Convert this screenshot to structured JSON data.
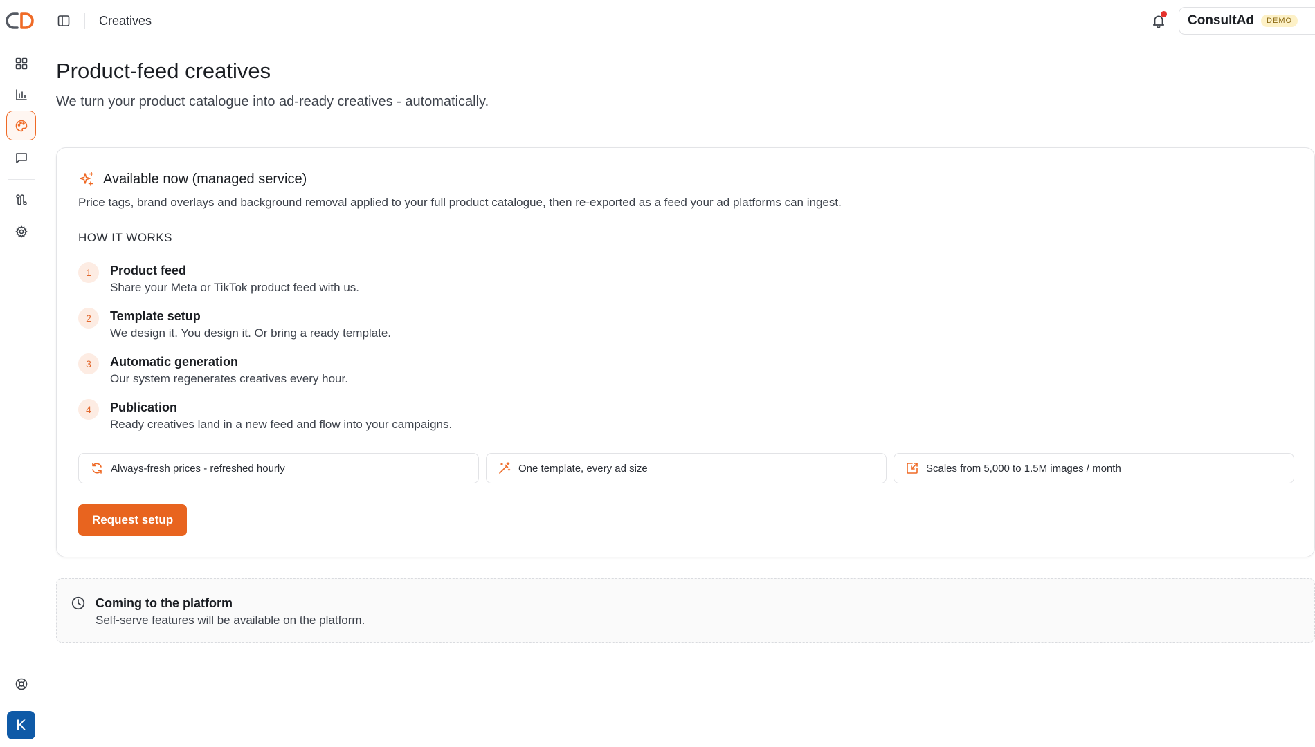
{
  "colors": {
    "accent": "#e8641f",
    "active_border": "#ef6a26",
    "avatar": "#0f5aa7",
    "notification_dot": "#e5322d"
  },
  "sidebar": {
    "items": [
      {
        "icon": "dashboard-icon"
      },
      {
        "icon": "bar-chart-icon"
      },
      {
        "icon": "palette-icon",
        "active": true
      },
      {
        "icon": "chat-icon"
      },
      {
        "icon": "integrations-icon"
      },
      {
        "icon": "gear-icon"
      },
      {
        "icon": "support-icon"
      }
    ],
    "avatar_initial": "K"
  },
  "header": {
    "breadcrumb": "Creatives",
    "workspace_name": "ConsultAd",
    "workspace_badge": "DEMO"
  },
  "page": {
    "title": "Product-feed creatives",
    "subtitle": "We turn your product catalogue into ad-ready creatives - automatically."
  },
  "card": {
    "title": "Available now (managed service)",
    "description": "Price tags, brand overlays and background removal applied to your full product catalogue, then re-exported as a feed your ad platforms can ingest.",
    "section_label": "HOW IT WORKS",
    "steps": [
      {
        "num": "1",
        "title": "Product feed",
        "desc": "Share your Meta or TikTok product feed with us."
      },
      {
        "num": "2",
        "title": "Template setup",
        "desc": "We design it. You design it. Or bring a ready template."
      },
      {
        "num": "3",
        "title": "Automatic generation",
        "desc": "Our system regenerates creatives every hour."
      },
      {
        "num": "4",
        "title": "Publication",
        "desc": "Ready creatives land in a new feed and flow into your campaigns."
      }
    ],
    "features": [
      {
        "icon": "refresh-icon",
        "label": "Always-fresh prices - refreshed hourly"
      },
      {
        "icon": "magic-wand-icon",
        "label": "One template, every ad size"
      },
      {
        "icon": "scale-icon",
        "label": "Scales from 5,000 to 1.5M images / month"
      }
    ],
    "button_label": "Request setup"
  },
  "coming": {
    "title": "Coming to the platform",
    "description": "Self-serve features will be available on the platform."
  }
}
